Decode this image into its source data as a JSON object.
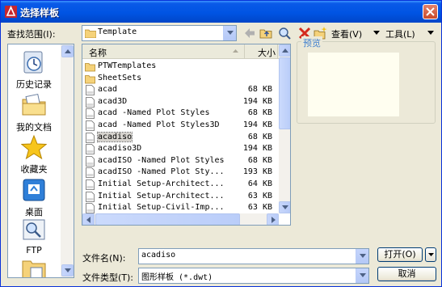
{
  "window": {
    "title": "选择样板"
  },
  "toolbar": {
    "look_in_label": "查找范围(I):",
    "look_in_value": "Template",
    "views_label": "查看(V)",
    "tools_label": "工具(L)"
  },
  "places": [
    {
      "label": "历史记录",
      "icon": "history-icon"
    },
    {
      "label": "我的文档",
      "icon": "my-documents-icon"
    },
    {
      "label": "收藏夹",
      "icon": "favorites-star-icon"
    },
    {
      "label": "桌面",
      "icon": "desktop-icon"
    },
    {
      "label": "FTP",
      "icon": "ftp-icon"
    },
    {
      "label": "",
      "icon": "folder-icon"
    }
  ],
  "filelist": {
    "col_name": "名称",
    "col_size": "大小",
    "rows": [
      {
        "name": "PTWTemplates",
        "size": "",
        "type": "folder"
      },
      {
        "name": "SheetSets",
        "size": "",
        "type": "folder"
      },
      {
        "name": "acad",
        "size": "68 KB",
        "type": "dwt"
      },
      {
        "name": "acad3D",
        "size": "194 KB",
        "type": "dwt"
      },
      {
        "name": "acad -Named Plot Styles",
        "size": "68 KB",
        "type": "dwt"
      },
      {
        "name": "acad -Named Plot Styles3D",
        "size": "194 KB",
        "type": "dwt"
      },
      {
        "name": "acadiso",
        "size": "68 KB",
        "type": "dwt",
        "selected": true
      },
      {
        "name": "acadiso3D",
        "size": "194 KB",
        "type": "dwt"
      },
      {
        "name": "acadISO -Named Plot Styles",
        "size": "68 KB",
        "type": "dwt"
      },
      {
        "name": "acadISO -Named Plot Sty...",
        "size": "193 KB",
        "type": "dwt"
      },
      {
        "name": "Initial Setup-Architect...",
        "size": "64 KB",
        "type": "dwt"
      },
      {
        "name": "Initial Setup-Architect...",
        "size": "63 KB",
        "type": "dwt"
      },
      {
        "name": "Initial Setup-Civil-Imp...",
        "size": "63 KB",
        "type": "dwt"
      }
    ]
  },
  "preview": {
    "label": "预览"
  },
  "filename": {
    "label": "文件名(N):",
    "value": "acadiso"
  },
  "filetype": {
    "label": "文件类型(T):",
    "value": "图形样板 (*.dwt)"
  },
  "buttons": {
    "open": "打开(O)",
    "cancel": "取消"
  },
  "colors": {
    "titlebar": "#0054e3",
    "dialog_bg": "#ece9d8",
    "border": "#7f9db9",
    "accent_blue": "#3f7fcf"
  }
}
